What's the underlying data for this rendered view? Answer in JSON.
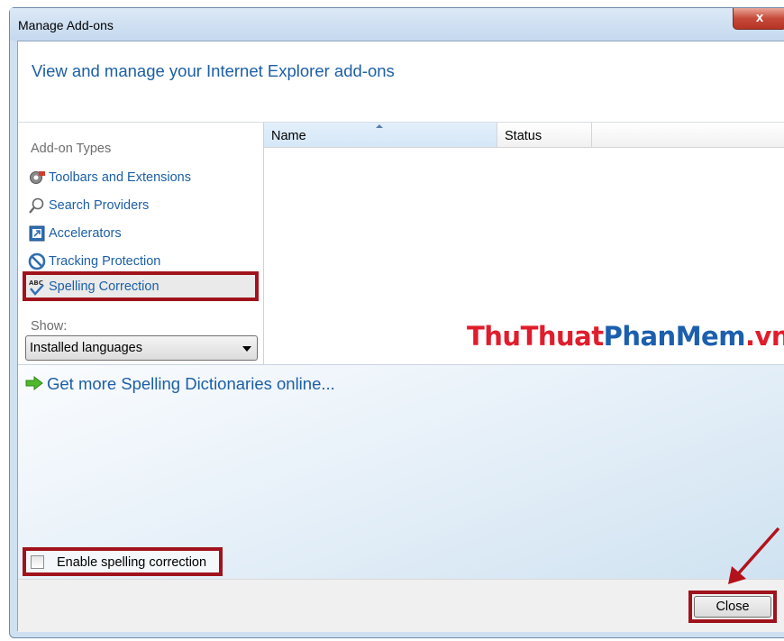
{
  "window": {
    "title": "Manage Add-ons",
    "close_glyph": "x"
  },
  "header": {
    "text": "View and manage your Internet Explorer add-ons"
  },
  "addon_types": {
    "label": "Add-on Types",
    "items": [
      {
        "label": "Toolbars and Extensions",
        "icon": "gear-icon"
      },
      {
        "label": "Search Providers",
        "icon": "magnifier-icon"
      },
      {
        "label": "Accelerators",
        "icon": "accelerator-icon"
      },
      {
        "label": "Tracking Protection",
        "icon": "no-entry-icon"
      },
      {
        "label": "Spelling Correction",
        "icon": "abc-check-icon",
        "selected": true
      }
    ]
  },
  "show": {
    "label": "Show:",
    "selected": "Installed languages"
  },
  "list": {
    "columns": [
      "Name",
      "Status"
    ]
  },
  "watermark": {
    "part1": "ThuThuat",
    "part2": "PhanMem",
    "part3": ".vn"
  },
  "bottom": {
    "link": "Get more Spelling Dictionaries online...",
    "checkbox_label": "Enable spelling correction",
    "checkbox_checked": false
  },
  "footer": {
    "close_label": "Close"
  },
  "colors": {
    "link": "#1c5fa6",
    "highlight": "#a0131c",
    "watermark_red": "#e01d2c",
    "watermark_blue": "#1b5fae"
  }
}
